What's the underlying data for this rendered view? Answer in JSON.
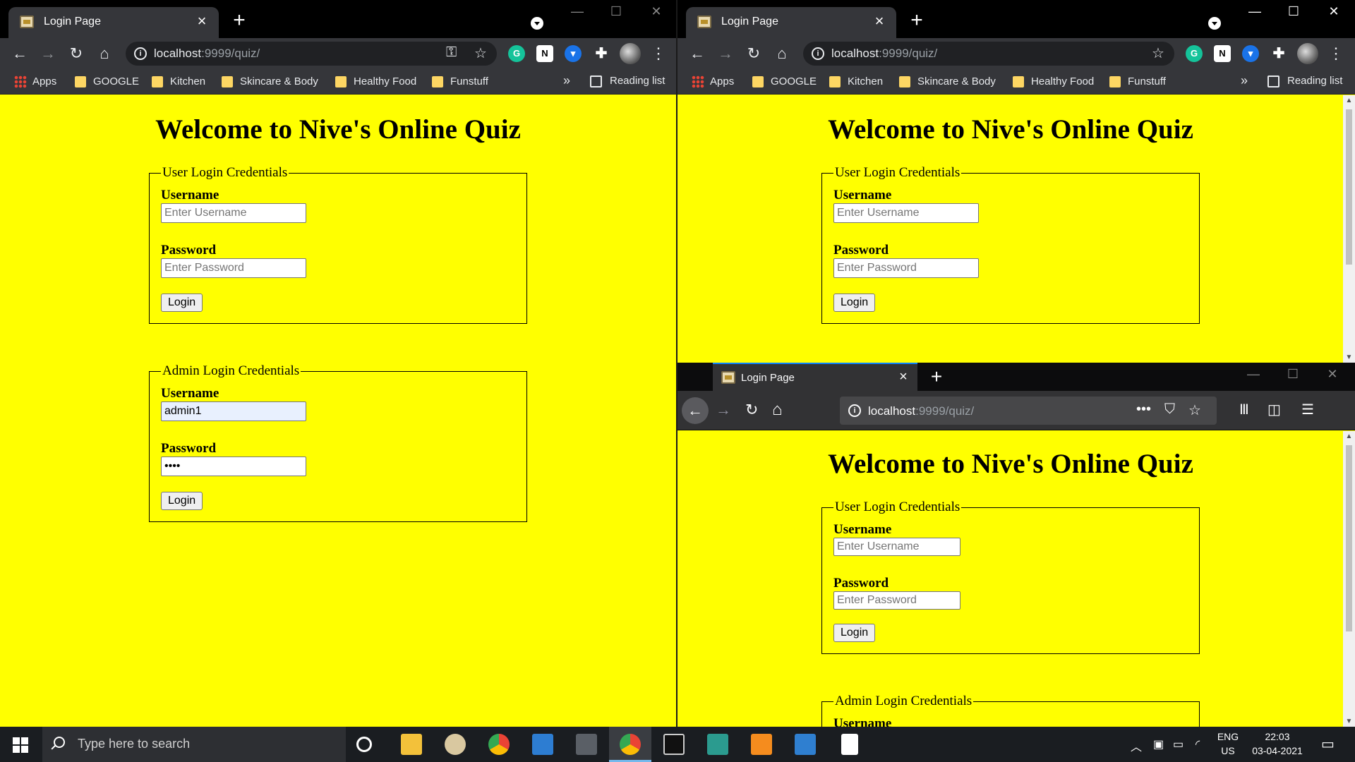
{
  "quiz_page": {
    "title": "Welcome to Nive's Online Quiz",
    "user_legend": "User Login Credentials",
    "admin_legend": "Admin Login Credentials",
    "username_label": "Username",
    "password_label": "Password",
    "username_placeholder": "Enter Username",
    "password_placeholder": "Enter Password",
    "login_label": "Login",
    "admin_username_value": "admin1",
    "admin_password_value": "••••"
  },
  "browser": {
    "tab_title": "Login Page",
    "url_host": "localhost",
    "url_rest": ":9999/quiz/",
    "bookmarks": [
      "Apps",
      "GOOGLE",
      "Kitchen",
      "Skincare & Body",
      "Healthy Food",
      "Funstuff"
    ],
    "bookmarks_more": "»",
    "reading_list": "Reading list"
  },
  "taskbar": {
    "search_placeholder": "Type here to search",
    "language": "ENG",
    "region": "US",
    "time": "22:03",
    "date": "03-04-2021"
  },
  "colors": {
    "page_background": "#ffff00",
    "chrome_frame": "#35363a",
    "firefox_frame": "#323234",
    "taskbar": "#1a1d21"
  }
}
